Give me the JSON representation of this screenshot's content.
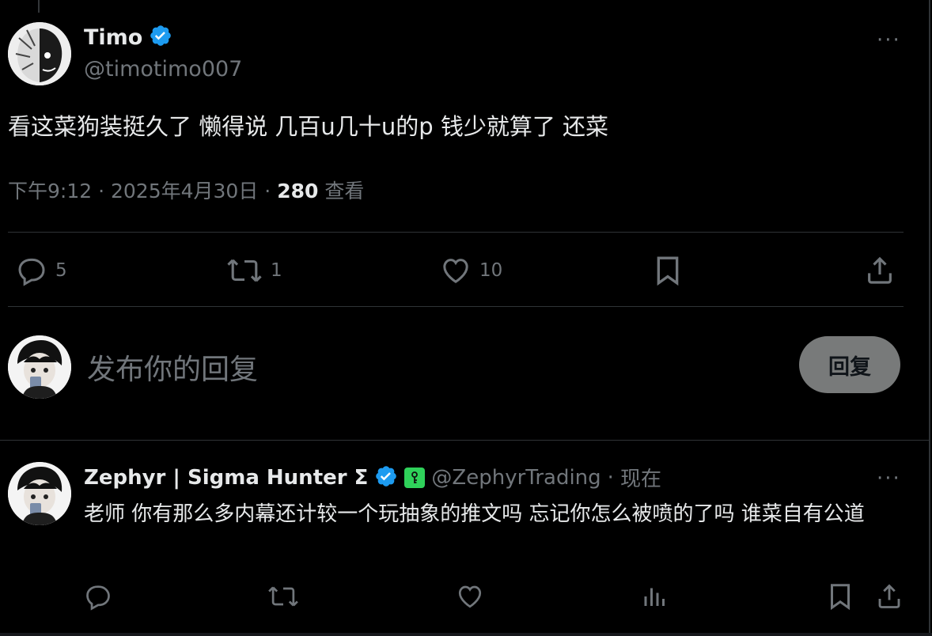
{
  "tweet": {
    "author_name": "Timo",
    "author_handle": "@timotimo007",
    "text": "看这菜狗装挺久了 懒得说 几百u几十u的p 钱少就算了 还菜",
    "time": "下午9:12",
    "sep": "·",
    "date": "2025年4月30日",
    "views_count": "280",
    "views_label": "查看",
    "more": "···",
    "actions": {
      "replies": "5",
      "retweets": "1",
      "likes": "10"
    }
  },
  "composer": {
    "placeholder": "发布你的回复",
    "button_label": "回复"
  },
  "reply": {
    "author_name": "Zephyr | Sigma Hunter Σ",
    "author_handle": "@ZephyrTrading",
    "sep": "·",
    "time": "现在",
    "text": "老师 你有那么多内幕还计较一个玩抽象的推文吗 忘记你怎么被喷的了吗 谁菜自有公道",
    "more": "···"
  },
  "colors": {
    "background": "#000000",
    "text": "#e7e9ea",
    "muted": "#71767b",
    "verified": "#1d9bf0",
    "divider": "#2f3336",
    "reply_button": "#787a7a",
    "badge": "#2fd15a"
  },
  "icons": [
    "verified-badge-icon",
    "more-icon",
    "reply-icon",
    "retweet-icon",
    "like-icon",
    "bookmark-icon",
    "share-icon",
    "analytics-icon",
    "key-badge-icon"
  ]
}
